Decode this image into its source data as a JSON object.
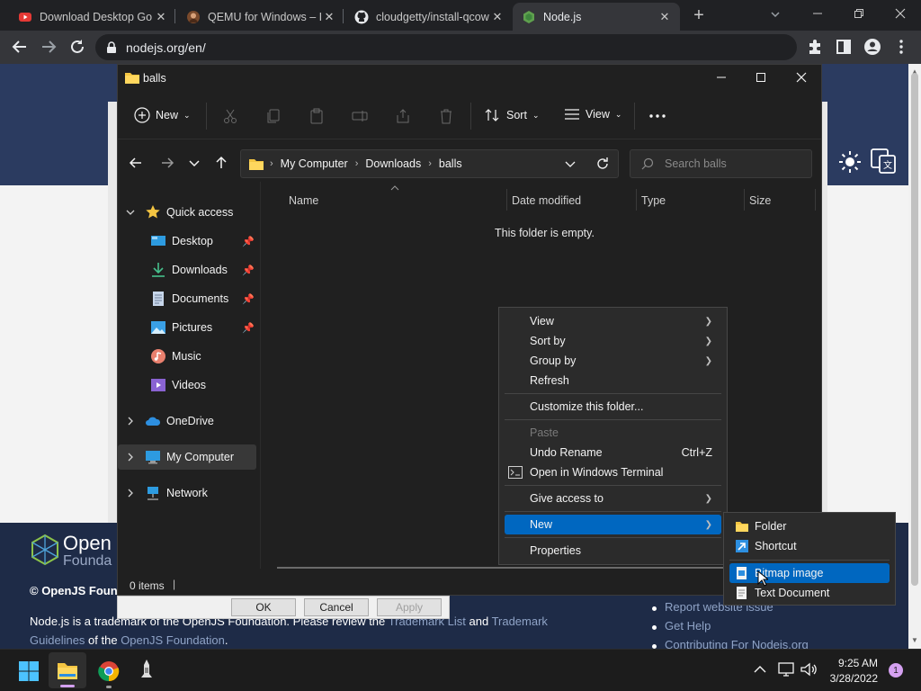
{
  "browser": {
    "tabs": [
      {
        "title": "Download Desktop Go",
        "favicon": "youtube-icon"
      },
      {
        "title": "QEMU for Windows – I",
        "favicon": "avatar-icon"
      },
      {
        "title": "cloudgetty/install-qcow",
        "favicon": "github-icon"
      },
      {
        "title": "Node.js",
        "favicon": "nodejs-icon"
      }
    ],
    "url": "nodejs.org/en/"
  },
  "webpage": {
    "logo_top": "Open",
    "logo_bottom": "Founda",
    "copyright": "© OpenJS Foun",
    "trademark_line1_a": "Node.js is a trademark of the OpenJS Foundation. Please review the ",
    "trademark_link1": "Trademark List",
    "trademark_line1_b": " and ",
    "trademark_link2": "Trademark",
    "trademark_line2_link": "Guidelines",
    "trademark_line2_a": " of the ",
    "trademark_link3": "OpenJS Foundation",
    "trademark_line2_b": ".",
    "links": [
      "Report website issue",
      "Get Help",
      "Contributing For Nodejs.org"
    ]
  },
  "explorer": {
    "title": "balls",
    "toolbar": {
      "new": "New",
      "sort": "Sort",
      "view": "View"
    },
    "breadcrumb": [
      "My Computer",
      "Downloads",
      "balls"
    ],
    "search_placeholder": "Search balls",
    "nav": {
      "quick_access": "Quick access",
      "items": [
        {
          "label": "Desktop",
          "icon": "desktop-icon",
          "pinned": true
        },
        {
          "label": "Downloads",
          "icon": "downloads-icon",
          "pinned": true
        },
        {
          "label": "Documents",
          "icon": "documents-icon",
          "pinned": true
        },
        {
          "label": "Pictures",
          "icon": "pictures-icon",
          "pinned": true
        },
        {
          "label": "Music",
          "icon": "music-icon",
          "pinned": false
        },
        {
          "label": "Videos",
          "icon": "videos-icon",
          "pinned": false
        }
      ],
      "onedrive": "OneDrive",
      "my_computer": "My Computer",
      "network": "Network"
    },
    "columns": [
      "Name",
      "Date modified",
      "Type",
      "Size"
    ],
    "empty_text": "This folder is empty.",
    "status": "0 items"
  },
  "context_menu": {
    "items": [
      {
        "label": "View",
        "submenu": true
      },
      {
        "label": "Sort by",
        "submenu": true
      },
      {
        "label": "Group by",
        "submenu": true
      },
      {
        "label": "Refresh"
      },
      {
        "label": "Customize this folder..."
      },
      {
        "label": "Paste",
        "disabled": true
      },
      {
        "label": "Undo Rename",
        "shortcut": "Ctrl+Z"
      },
      {
        "label": "Open in Windows Terminal"
      },
      {
        "label": "Give access to",
        "submenu": true
      },
      {
        "label": "New",
        "submenu": true,
        "highlighted": true
      },
      {
        "label": "Properties"
      }
    ]
  },
  "new_submenu": {
    "items": [
      {
        "label": "Folder",
        "icon": "folder-icon"
      },
      {
        "label": "Shortcut",
        "icon": "shortcut-icon"
      },
      {
        "label": "Bitmap image",
        "icon": "bitmap-icon",
        "highlighted": true
      },
      {
        "label": "Text Document",
        "icon": "text-document-icon"
      }
    ]
  },
  "dialog_buttons": {
    "ok": "OK",
    "cancel": "Cancel",
    "apply": "Apply"
  },
  "taskbar": {
    "time": "9:25 AM",
    "date": "3/28/2022",
    "notification_count": "1"
  },
  "colors": {
    "highlight": "#0067c0",
    "explorer_bg": "#202020",
    "menu_bg": "#2b2b2b"
  }
}
